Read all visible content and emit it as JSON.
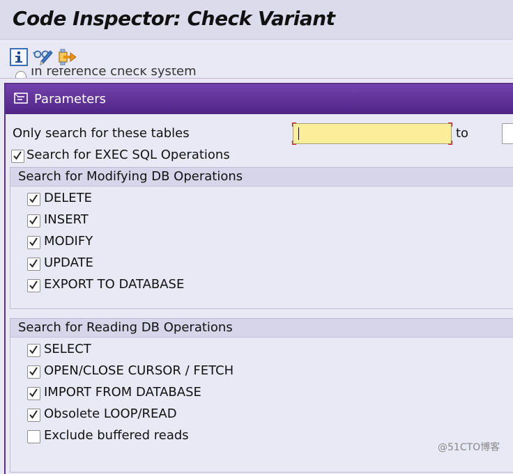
{
  "window": {
    "title": "Code Inspector: Check Variant"
  },
  "toolbar": {
    "items": [
      "info-icon",
      "glasses-pencil-icon",
      "transport-icon"
    ]
  },
  "cut_off": {
    "text": "In reference check system"
  },
  "parameters": {
    "title": "Parameters",
    "tables": {
      "label": "Only search for these tables",
      "from_value": "",
      "to_label": "to",
      "to_value": ""
    },
    "exec_sql": {
      "label": "Search for EXEC SQL Operations",
      "checked": true
    }
  },
  "modifying": {
    "title": "Search for Modifying DB Operations",
    "items": [
      {
        "label": "DELETE",
        "checked": true
      },
      {
        "label": "INSERT",
        "checked": true
      },
      {
        "label": "MODIFY",
        "checked": true
      },
      {
        "label": "UPDATE",
        "checked": true
      },
      {
        "label": "EXPORT TO DATABASE",
        "checked": true
      }
    ]
  },
  "reading": {
    "title": "Search for Reading DB Operations",
    "items": [
      {
        "label": "SELECT",
        "checked": true
      },
      {
        "label": "OPEN/CLOSE CURSOR / FETCH",
        "checked": true
      },
      {
        "label": "IMPORT FROM DATABASE",
        "checked": true
      },
      {
        "label": "Obsolete LOOP/READ",
        "checked": true
      },
      {
        "label": "Exclude buffered reads",
        "checked": false
      }
    ]
  },
  "watermark": "@51CTO博客"
}
